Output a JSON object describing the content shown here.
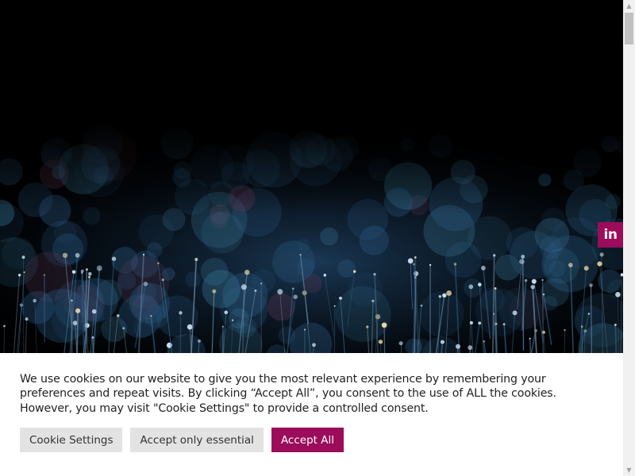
{
  "social": {
    "linkedin_label": "in",
    "linkedin_icon": "linkedin-icon"
  },
  "cookie": {
    "message": "We use cookies on our website to give you the most relevant experience by remembering your preferences and repeat visits. By clicking “Accept All”, you consent to the use of ALL the cookies. However, you may visit \"Cookie Settings\" to provide a controlled consent.",
    "settings_label": "Cookie Settings",
    "essential_label": "Accept only essential",
    "accept_all_label": "Accept All"
  },
  "scrollbar": {
    "up_icon": "arrow-up-icon",
    "down_icon": "arrow-down-icon"
  },
  "colors": {
    "accent": "#9b0c5a",
    "button_grey": "#e3e3e3",
    "banner_bg": "#ffffff",
    "hero_bg": "#000000"
  }
}
